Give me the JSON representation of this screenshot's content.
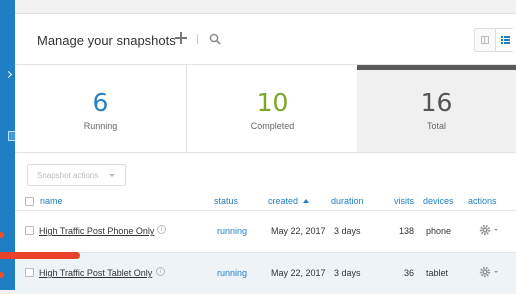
{
  "header": {
    "title": "Manage your snapshots"
  },
  "stats": [
    {
      "value": "6",
      "label": "Running",
      "color": "#2a7fc0"
    },
    {
      "value": "10",
      "label": "Completed",
      "color": "#7aa62a"
    },
    {
      "value": "16",
      "label": "Total",
      "color": "#555555"
    }
  ],
  "toolbar": {
    "actions_label": "Snapshot actions"
  },
  "table": {
    "columns": {
      "name": "name",
      "status": "status",
      "created": "created",
      "duration": "duration",
      "visits": "visits",
      "devices": "devices",
      "actions": "actions"
    },
    "rows": [
      {
        "name": "High Traffic Post Phone Only",
        "status": "running",
        "created": "May 22, 2017",
        "duration": "3 days",
        "visits": "138",
        "devices": "phone"
      },
      {
        "name": "High Traffic Post Tablet Only",
        "status": "running",
        "created": "May 22, 2017",
        "duration": "3 days",
        "visits": "36",
        "devices": "tablet"
      }
    ]
  },
  "icons": [
    "add-icon",
    "search-icon",
    "grid-view-icon",
    "list-view-icon",
    "info-icon",
    "gear-icon",
    "sort-ascending-icon"
  ],
  "colors": {
    "accent": "#1f7fc4",
    "annotation": "#e8432a"
  }
}
